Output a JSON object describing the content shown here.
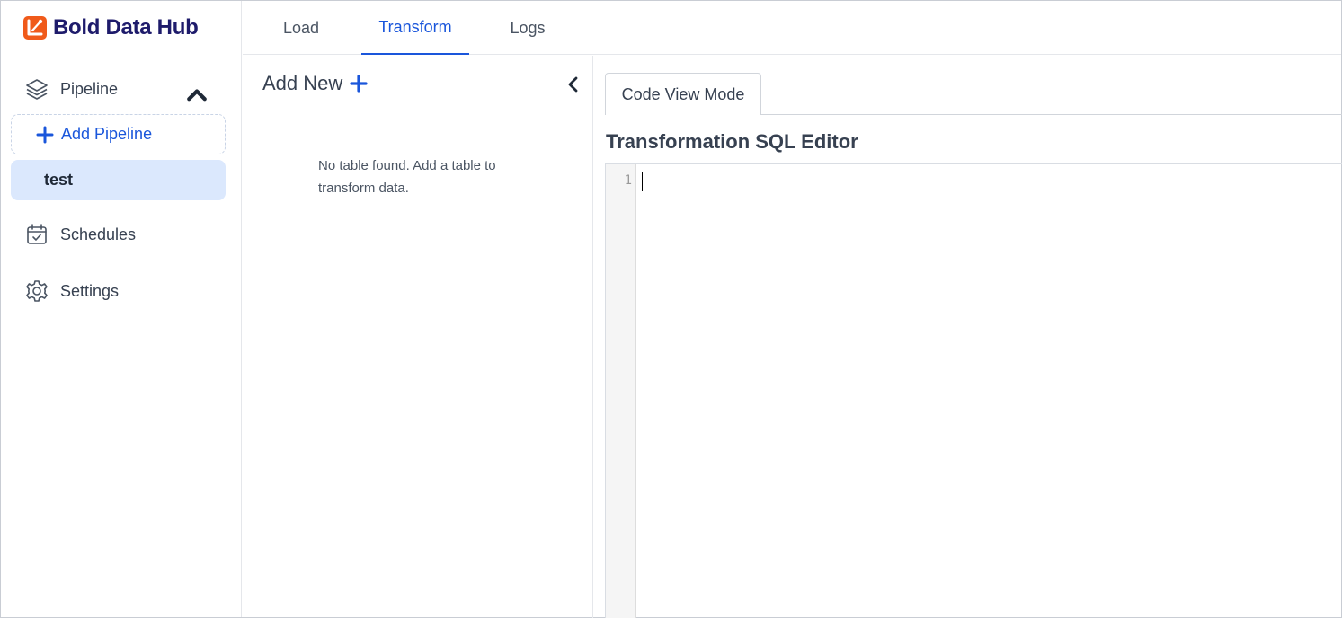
{
  "app": {
    "name": "Bold Data Hub",
    "brand_color": "#f05a1a",
    "accent_color": "#1a56db"
  },
  "sidebar": {
    "pipeline": {
      "label": "Pipeline",
      "icon": "layers-icon",
      "expanded": true
    },
    "add_pipeline_label": "Add Pipeline",
    "pipelines": [
      {
        "label": "test",
        "selected": true
      }
    ],
    "schedules": {
      "label": "Schedules",
      "icon": "calendar-check-icon"
    },
    "settings": {
      "label": "Settings",
      "icon": "gear-icon"
    }
  },
  "tabs": [
    {
      "label": "Load",
      "active": false
    },
    {
      "label": "Transform",
      "active": true
    },
    {
      "label": "Logs",
      "active": false
    }
  ],
  "table_panel": {
    "add_new_label": "Add New",
    "empty_message": "No table found. Add a table to transform data."
  },
  "editor": {
    "mode_tab_label": "Code View Mode",
    "title": "Transformation SQL Editor",
    "line_numbers": [
      "1"
    ]
  }
}
